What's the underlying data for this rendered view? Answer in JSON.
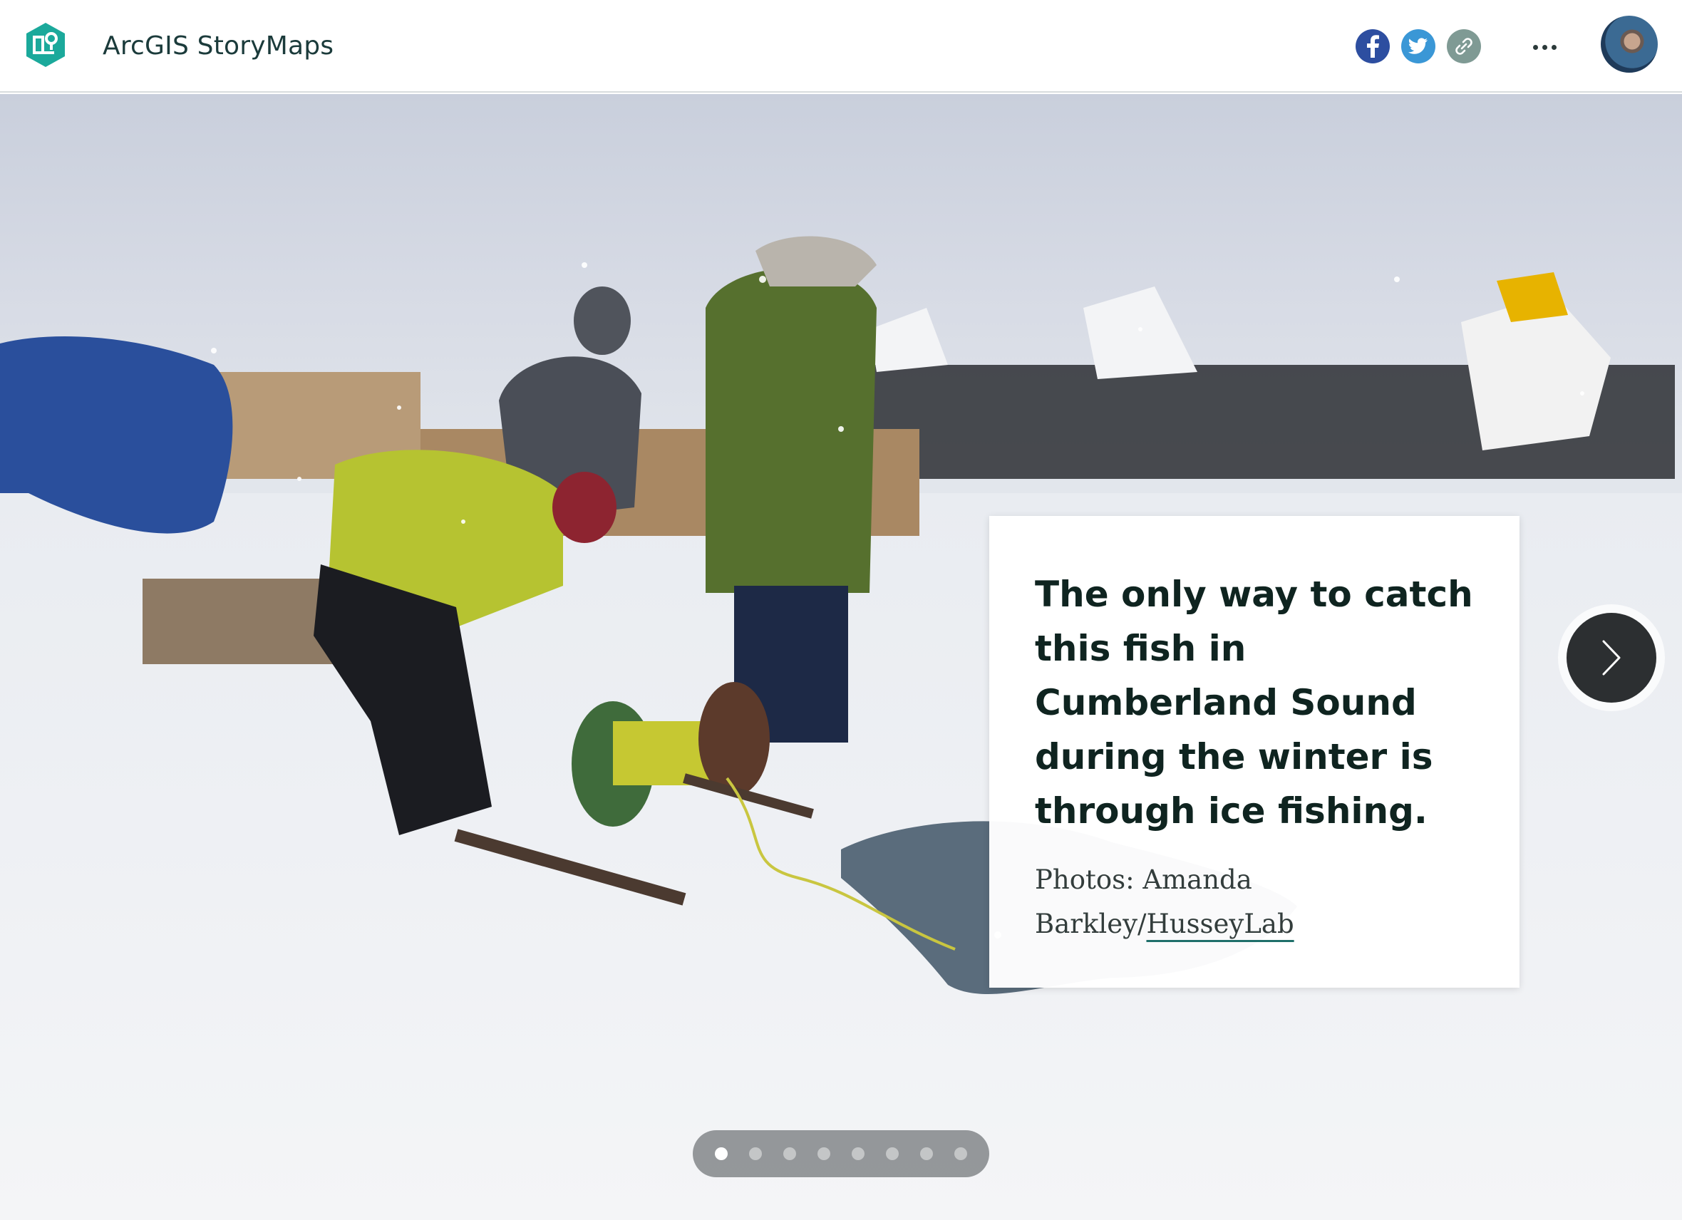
{
  "header": {
    "app_title": "ArcGIS StoryMaps",
    "logo_icon": "storymaps-logo-icon",
    "share": [
      {
        "name": "facebook-icon",
        "color": "#2d4ea0"
      },
      {
        "name": "twitter-icon",
        "color": "#3a97d6"
      },
      {
        "name": "link-icon",
        "color": "#7f9a94"
      }
    ],
    "more_icon": "more-options-icon",
    "avatar": "user-avatar"
  },
  "slide": {
    "image": "ice-fishing-photo",
    "caption_heading": "The only way to catch this fish in Cumberland Sound during the winter is through ice fishing.",
    "credit_prefix": "Photos: Amanda Barkley/",
    "credit_link": "HusseyLab",
    "next_icon": "chevron-right-icon"
  },
  "pagination": {
    "total": 8,
    "current": 1
  },
  "colors": {
    "heading": "#0f2420",
    "accent": "#1f6f6a"
  }
}
